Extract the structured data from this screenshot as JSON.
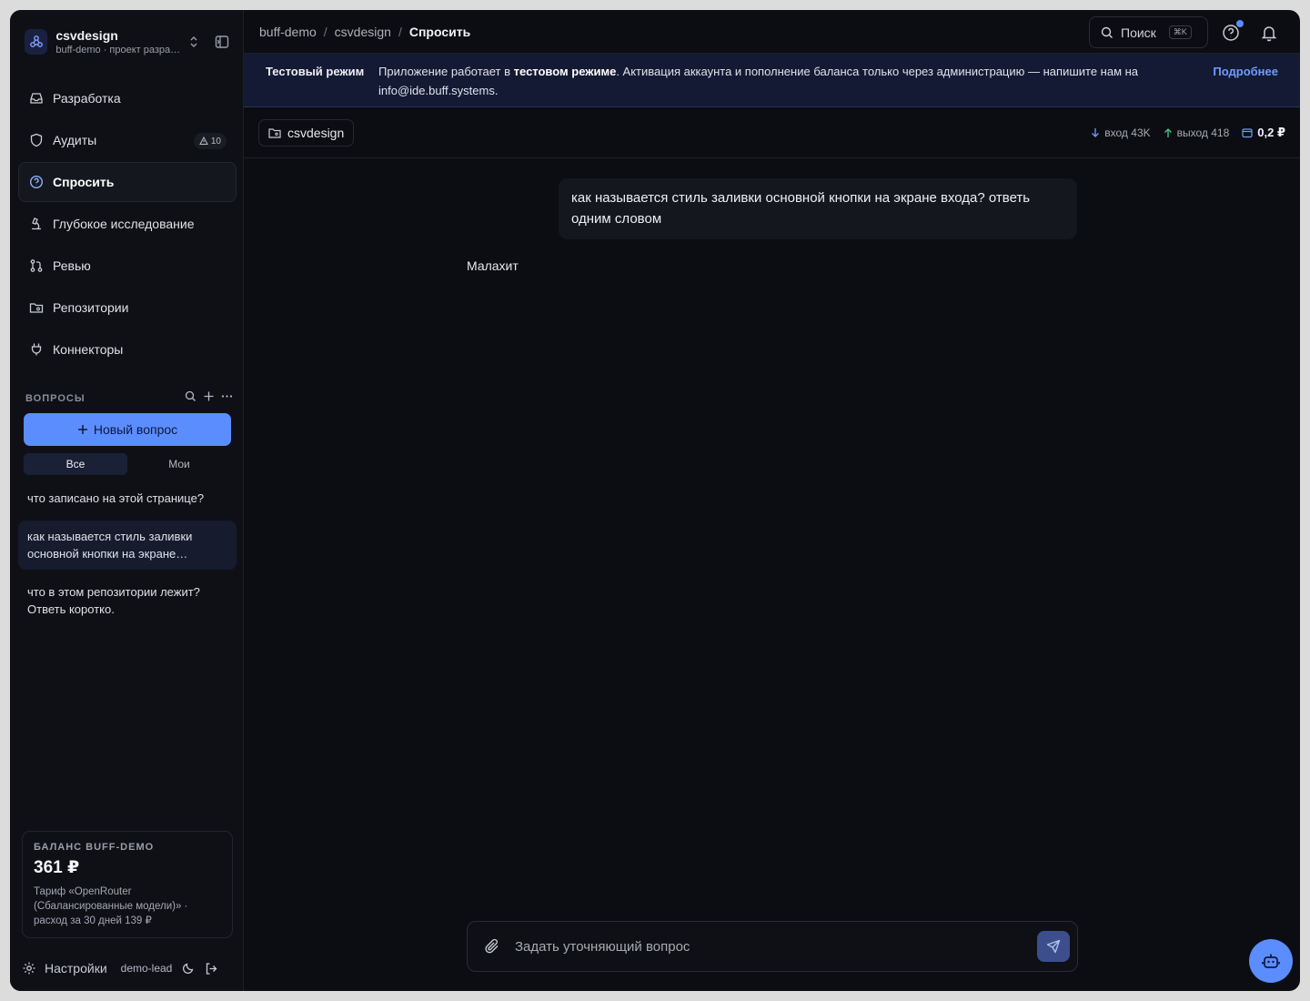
{
  "workspace": {
    "name": "csvdesign",
    "subtitle": "buff-demo · проект разработки"
  },
  "nav": {
    "items": [
      {
        "label": "Разработка"
      },
      {
        "label": "Аудиты",
        "badge": "10"
      },
      {
        "label": "Спросить"
      },
      {
        "label": "Глубокое исследование"
      },
      {
        "label": "Ревью"
      },
      {
        "label": "Репозитории"
      },
      {
        "label": "Коннекторы"
      }
    ]
  },
  "questions": {
    "title": "ВОПРОСЫ",
    "new_button": "Новый вопрос",
    "tabs": [
      "Все",
      "Мои"
    ],
    "items": [
      {
        "text": "что записано на этой странице?"
      },
      {
        "text": "как называется стиль заливки основной кнопки на экране входа? ответь одним словом"
      },
      {
        "text": "что в этом репозитории лежит? Ответь коротко."
      }
    ]
  },
  "balance": {
    "label": "БАЛАНС BUFF-DEMO",
    "value": "361 ₽",
    "description": "Тариф «OpenRouter (Сбалансированные модели)» · расход за 30 дней 139 ₽"
  },
  "footer": {
    "settings": "Настройки",
    "user": "demo-lead"
  },
  "topbar": {
    "crumbs": [
      "buff-demo",
      "csvdesign",
      "Спросить"
    ],
    "search_label": "Поиск",
    "search_kbd": "⌘K"
  },
  "banner": {
    "title": "Тестовый режим",
    "text_pre": "Приложение работает в ",
    "text_bold": "тестовом режиме",
    "text_post": ". Активация аккаунта и пополнение баланса только через администрацию — напишите нам на info@ide.buff.systems.",
    "link": "Подробнее"
  },
  "subbar": {
    "repo": "csvdesign",
    "input_tokens": "вход 43K",
    "output_tokens": "выход 418",
    "cost": "0,2 ₽"
  },
  "chat": {
    "user_message": "как называется стиль заливки основной кнопки на экране входа? ответь одним словом",
    "answer": "Малахит"
  },
  "composer": {
    "placeholder": "Задать уточняющий вопрос"
  },
  "colors": {
    "accent": "#5b8dff",
    "background": "#0c0d12",
    "banner": "#141a33"
  }
}
